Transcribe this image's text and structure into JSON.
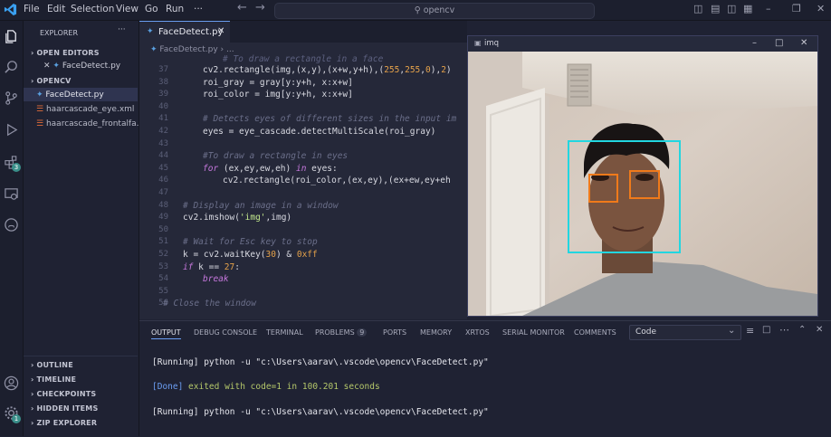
{
  "menu": [
    "File",
    "Edit",
    "Selection",
    "View",
    "Go",
    "Run",
    "···"
  ],
  "search_placeholder": "opencv",
  "sidebar": {
    "header": "EXPLORER",
    "open_editors_label": "OPEN EDITORS",
    "open_editor_file": "FaceDetect.py",
    "folder_label": "OPENCV",
    "files": [
      "FaceDetect.py",
      "haarcascade_eye.xml",
      "haarcascade_frontalfa..."
    ],
    "bottom_sections": [
      "OUTLINE",
      "TIMELINE",
      "CHECKPOINTS",
      "HIDDEN ITEMS",
      "ZIP EXPLORER"
    ]
  },
  "activity_badges": {
    "extensions": "3",
    "accounts": "1"
  },
  "editor": {
    "tab_label": "FaceDetect.py",
    "breadcrumb_file": "FaceDetect.py",
    "breadcrumb_more": "...",
    "lines": [
      {
        "n": "37",
        "t": "cv2.rectangle(img,(x,y),(x+w,y+h),(255,255,0),2)"
      },
      {
        "n": "38",
        "t": "roi_gray = gray[y:y+h, x:x+w]"
      },
      {
        "n": "39",
        "t": "roi_color = img[y:y+h, x:x+w]"
      },
      {
        "n": "40",
        "t": ""
      },
      {
        "n": "41",
        "t": "# Detects eyes of different sizes in the input im"
      },
      {
        "n": "42",
        "t": "eyes = eye_cascade.detectMultiScale(roi_gray)"
      },
      {
        "n": "43",
        "t": ""
      },
      {
        "n": "44",
        "t": "#To draw a rectangle in eyes"
      },
      {
        "n": "45",
        "t": "for (ex,ey,ew,eh) in eyes:"
      },
      {
        "n": "46",
        "t": "cv2.rectangle(roi_color,(ex,ey),(ex+ew,ey+eh"
      },
      {
        "n": "47",
        "t": ""
      },
      {
        "n": "48",
        "t": "# Display an image in a window"
      },
      {
        "n": "49",
        "t": "cv2.imshow('img',img)"
      },
      {
        "n": "50",
        "t": ""
      },
      {
        "n": "51",
        "t": "# Wait for Esc key to stop"
      },
      {
        "n": "52",
        "t": "k = cv2.waitKey(30) & 0xff"
      },
      {
        "n": "53",
        "t": "if k == 27:"
      },
      {
        "n": "54",
        "t": "break"
      },
      {
        "n": "55",
        "t": ""
      },
      {
        "n": "56",
        "t": "# Close the window"
      }
    ],
    "top_partial": "# To draw a rectangle in a face"
  },
  "panel": {
    "tabs": [
      "OUTPUT",
      "DEBUG CONSOLE",
      "TERMINAL",
      "PROBLEMS",
      "PORTS",
      "MEMORY",
      "XRTOS",
      "SERIAL MONITOR",
      "COMMENTS"
    ],
    "problems_count": "9",
    "dropdown_value": "Code",
    "lines": [
      "[Running] python -u \"c:\\Users\\aarav\\.vscode\\opencv\\FaceDetect.py\"",
      "[Done] exited with code=1 in 100.201 seconds",
      "[Running] python -u \"c:\\Users\\aarav\\.vscode\\opencv\\FaceDetect.py\""
    ]
  },
  "imq": {
    "title": "imq",
    "minimize": "–",
    "maximize": "□",
    "close": "✕"
  },
  "colors": {
    "accent": "#6b9ef3",
    "face_box": "#22d6e0",
    "eye_box": "#f07a1a"
  }
}
